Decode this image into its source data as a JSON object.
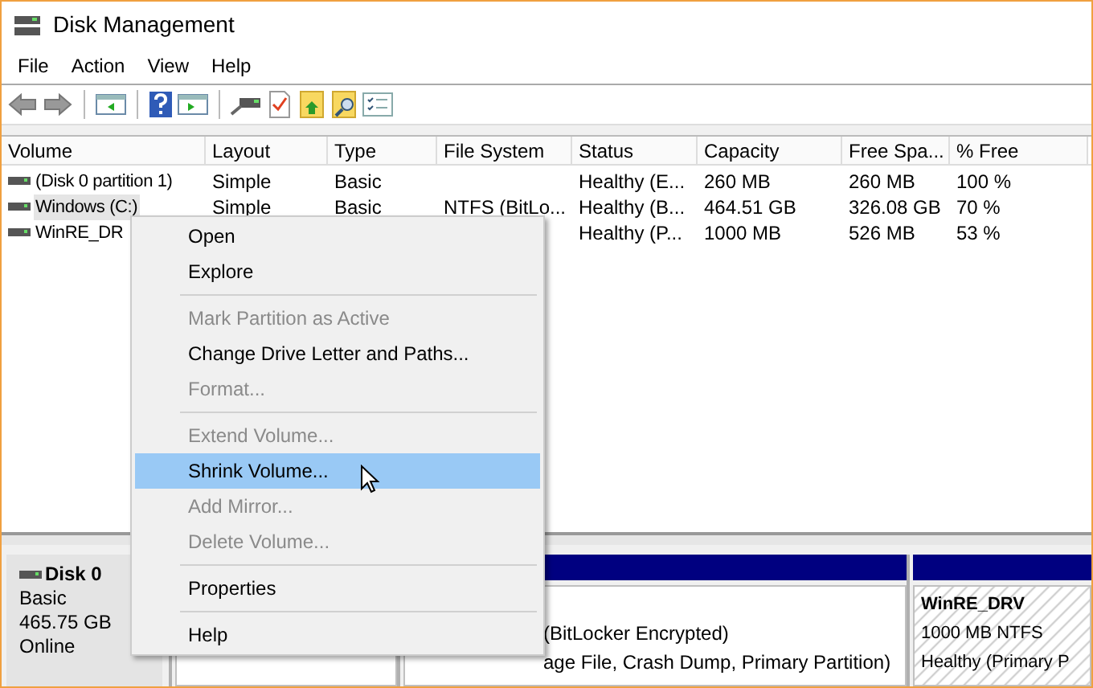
{
  "window": {
    "title": "Disk Management"
  },
  "menu_bar": [
    "File",
    "Action",
    "View",
    "Help"
  ],
  "volume_list": {
    "columns": [
      "Volume",
      "Layout",
      "Type",
      "File System",
      "Status",
      "Capacity",
      "Free Spa...",
      "% Free"
    ],
    "rows": [
      {
        "selected": false,
        "cells": [
          "(Disk 0 partition 1)",
          "Simple",
          "Basic",
          "",
          "Healthy (E...",
          "260 MB",
          "260 MB",
          "100 %"
        ]
      },
      {
        "selected": true,
        "cells": [
          "Windows (C:)",
          "Simple",
          "Basic",
          "NTFS (BitLo...",
          "Healthy (B...",
          "464.51 GB",
          "326.08 GB",
          "70 %"
        ]
      },
      {
        "selected": false,
        "cells": [
          "WinRE_DR",
          "",
          "",
          "",
          "Healthy (P...",
          "1000 MB",
          "526 MB",
          "53 %"
        ]
      }
    ]
  },
  "context_menu": [
    {
      "kind": "item",
      "label": "Open",
      "disabled": false,
      "selected": false
    },
    {
      "kind": "item",
      "label": "Explore",
      "disabled": false,
      "selected": false
    },
    {
      "kind": "separator"
    },
    {
      "kind": "item",
      "label": "Mark Partition as Active",
      "disabled": true,
      "selected": false
    },
    {
      "kind": "item",
      "label": "Change Drive Letter and Paths...",
      "disabled": false,
      "selected": false
    },
    {
      "kind": "item",
      "label": "Format...",
      "disabled": true,
      "selected": false
    },
    {
      "kind": "separator"
    },
    {
      "kind": "item",
      "label": "Extend Volume...",
      "disabled": true,
      "selected": false
    },
    {
      "kind": "item",
      "label": "Shrink Volume...",
      "disabled": false,
      "selected": true
    },
    {
      "kind": "item",
      "label": "Add Mirror...",
      "disabled": true,
      "selected": false
    },
    {
      "kind": "item",
      "label": "Delete Volume...",
      "disabled": true,
      "selected": false
    },
    {
      "kind": "separator"
    },
    {
      "kind": "item",
      "label": "Properties",
      "disabled": false,
      "selected": false
    },
    {
      "kind": "separator"
    },
    {
      "kind": "item",
      "label": "Help",
      "disabled": false,
      "selected": false
    }
  ],
  "disk": {
    "name": "Disk 0",
    "lines": [
      "Basic",
      "465.75 GB",
      "Online"
    ],
    "partitions": [
      {
        "selected": false
      },
      {
        "selected": false,
        "lines": [
          "(BitLocker Encrypted)",
          "age File, Crash Dump, Primary Partition)"
        ]
      },
      {
        "selected": true,
        "name": "WinRE_DRV",
        "lines": [
          "1000 MB NTFS",
          "Healthy (Primary P"
        ]
      }
    ]
  }
}
